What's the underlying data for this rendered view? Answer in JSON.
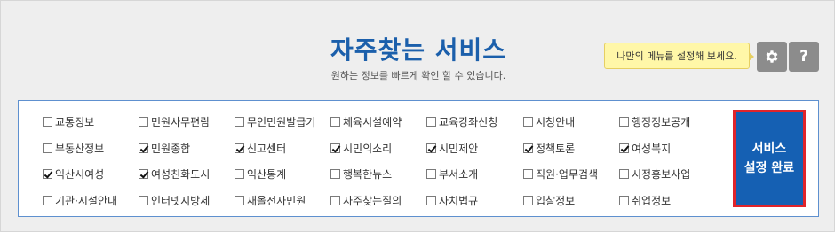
{
  "header": {
    "title": "자주찾는 서비스",
    "subtitle": "원하는 정보를 빠르게 확인 할 수 있습니다."
  },
  "tooltip": {
    "text": "나만의 메뉴를 설정해 보세요."
  },
  "buttons": {
    "settings_icon": "gear-icon",
    "help_icon": "question-icon",
    "help_glyph": "?",
    "done_line1": "서비스",
    "done_line2": "설정 완료"
  },
  "colors": {
    "accent": "#1b5fab",
    "done_button": "#1560b3",
    "done_border": "#e0242b",
    "panel_border": "#5e90cf",
    "tooltip_bg": "#fff7a8"
  },
  "services": [
    [
      {
        "label": "교통정보",
        "checked": false
      },
      {
        "label": "민원사무편람",
        "checked": false
      },
      {
        "label": "무인민원발급기",
        "checked": false
      },
      {
        "label": "체육시설예약",
        "checked": false
      },
      {
        "label": "교육강좌신청",
        "checked": false
      },
      {
        "label": "시청안내",
        "checked": false
      },
      {
        "label": "행정정보공개",
        "checked": false
      }
    ],
    [
      {
        "label": "부동산정보",
        "checked": false
      },
      {
        "label": "민원종합",
        "checked": true
      },
      {
        "label": "신고센터",
        "checked": true
      },
      {
        "label": "시민의소리",
        "checked": true
      },
      {
        "label": "시민제안",
        "checked": true
      },
      {
        "label": "정책토론",
        "checked": true
      },
      {
        "label": "여성복지",
        "checked": true
      }
    ],
    [
      {
        "label": "익산시여성",
        "checked": true
      },
      {
        "label": "여성친화도시",
        "checked": true
      },
      {
        "label": "익산통계",
        "checked": false
      },
      {
        "label": "행복한뉴스",
        "checked": false
      },
      {
        "label": "부서소개",
        "checked": false
      },
      {
        "label": "직원·업무검색",
        "checked": false
      },
      {
        "label": "시정홍보사업",
        "checked": false
      }
    ],
    [
      {
        "label": "기관·시설안내",
        "checked": false
      },
      {
        "label": "인터넷지방세",
        "checked": false
      },
      {
        "label": "새올전자민원",
        "checked": false
      },
      {
        "label": "자주찾는질의",
        "checked": false
      },
      {
        "label": "자치법규",
        "checked": false
      },
      {
        "label": "입찰정보",
        "checked": false
      },
      {
        "label": "취업정보",
        "checked": false
      }
    ]
  ]
}
